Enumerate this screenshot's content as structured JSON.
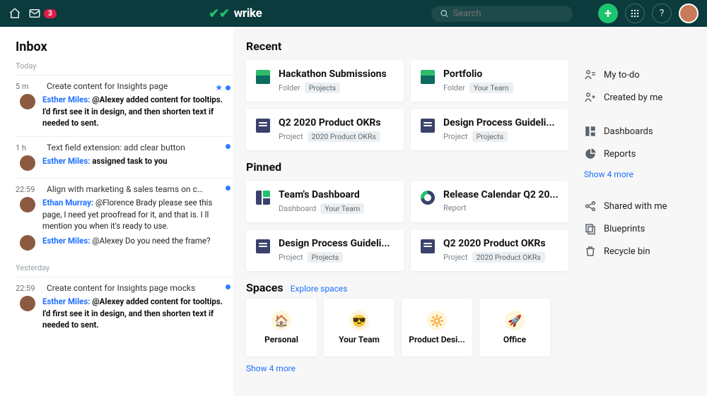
{
  "header": {
    "badge_count": "3",
    "app_name": "wrike",
    "search_placeholder": "Search"
  },
  "inbox": {
    "title": "Inbox",
    "group_labels": [
      "Today",
      "Yesterday"
    ],
    "items": [
      {
        "time": "5 m",
        "subject": "Create content for Insights page",
        "starred": true,
        "unread": true,
        "lines": [
          {
            "author": "Esther Miles:",
            "text": "@Alexey added content for tooltips. I'd first see it in design, and then shorten text if needed to sent.",
            "bold": true
          }
        ]
      },
      {
        "time": "1 h",
        "subject": "Text field extension: add clear button",
        "unread": true,
        "lines": [
          {
            "author": "Esther Miles:",
            "text": "assigned task to you",
            "bold": true
          }
        ]
      },
      {
        "time": "22:59",
        "subject": "Align with marketing & sales teams on co...",
        "unread": true,
        "lines": [
          {
            "author": "Ethan Murray:",
            "text": "@Florence Brady please see this page, I need yet proofread for it, and that is. I ll mention you when it's ready to use."
          },
          {
            "author": "Esther Miles:",
            "text": "@Alexey Do you need the frame?"
          }
        ]
      },
      {
        "time": "22:59",
        "subject": "Create content for Insights page mocks",
        "unread": true,
        "group": 1,
        "lines": [
          {
            "author": "Esther Miles:",
            "text": "@Alexey added content for tooltips. I'd first see it in design, and then shorten text if needed to sent.",
            "bold": true
          }
        ]
      }
    ]
  },
  "recent": {
    "title": "Recent",
    "cards": [
      {
        "icon": "folder",
        "title": "Hackathon Submissions",
        "type": "Folder",
        "tag": "Projects"
      },
      {
        "icon": "folder",
        "title": "Portfolio",
        "type": "Folder",
        "tag": "Your Team"
      },
      {
        "icon": "project",
        "title": "Q2 2020 Product OKRs",
        "type": "Project",
        "tag": "2020 Product OKRs"
      },
      {
        "icon": "project",
        "title": "Design Process Guideli...",
        "type": "Project",
        "tag": "Projects"
      }
    ]
  },
  "pinned": {
    "title": "Pinned",
    "cards": [
      {
        "icon": "dash",
        "title": "Team's Dashboard",
        "type": "Dashboard",
        "tag": "Your Team"
      },
      {
        "icon": "report",
        "title": "Release Calendar Q2 20...",
        "type": "Report",
        "tag": ""
      },
      {
        "icon": "project",
        "title": "Design Process Guideli...",
        "type": "Project",
        "tag": "Projects"
      },
      {
        "icon": "project",
        "title": "Q2 2020 Product OKRs",
        "type": "Project",
        "tag": "2020 Product OKRs"
      }
    ]
  },
  "spaces": {
    "title": "Spaces",
    "explore": "Explore spaces",
    "items": [
      {
        "emoji": "🏠",
        "label": "Personal"
      },
      {
        "emoji": "😎",
        "label": "Your Team"
      },
      {
        "emoji": "🔆",
        "label": "Product Desi..."
      },
      {
        "emoji": "🚀",
        "label": "Office"
      }
    ],
    "more": "Show 4 more"
  },
  "side": {
    "items_a": [
      {
        "icon": "todo",
        "label": "My to-do"
      },
      {
        "icon": "created",
        "label": "Created by me"
      }
    ],
    "items_b": [
      {
        "icon": "dash",
        "label": "Dashboards"
      },
      {
        "icon": "report",
        "label": "Reports"
      }
    ],
    "more": "Show 4 more",
    "items_c": [
      {
        "icon": "share",
        "label": "Shared with me"
      },
      {
        "icon": "blue",
        "label": "Blueprints"
      },
      {
        "icon": "bin",
        "label": "Recycle bin"
      }
    ]
  }
}
